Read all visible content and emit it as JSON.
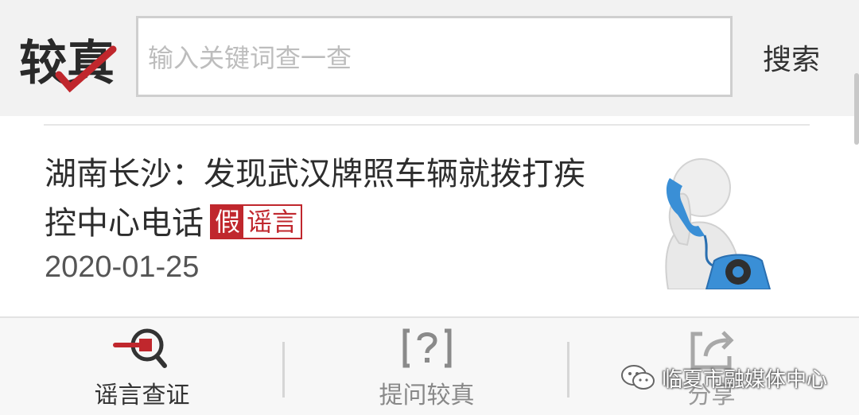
{
  "header": {
    "logo_text": "较真",
    "search_placeholder": "输入关键词查一查",
    "search_button": "搜索"
  },
  "article": {
    "title": "湖南长沙：发现武汉牌照车辆就拨打疾控中心电话",
    "verdict_false": "假",
    "verdict_rumor": "谣言",
    "date": "2020-01-25",
    "thumbnail_icon": "phone-call-figure-icon"
  },
  "bottom_nav": {
    "items": [
      {
        "label": "谣言查证",
        "icon": "magnifier-icon",
        "color": "#333333"
      },
      {
        "label": "提问较真",
        "icon": "question-box-icon",
        "color": "#888888"
      },
      {
        "label": "分享",
        "icon": "share-icon",
        "color": "#999999"
      }
    ]
  },
  "watermark": {
    "text": "临夏市融媒体中心",
    "icon": "wechat-icon"
  },
  "colors": {
    "brand_red": "#c0272d",
    "header_bg": "#f2f2f2",
    "accent_blue": "#3a8fd6"
  }
}
